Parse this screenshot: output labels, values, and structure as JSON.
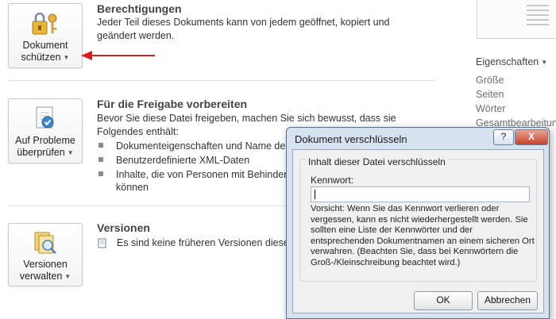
{
  "protect": {
    "button_line1": "Dokument",
    "button_line2": "schützen",
    "title": "Berechtigungen",
    "text": "Jeder Teil dieses Dokuments kann von jedem geöffnet, kopiert und geändert werden."
  },
  "inspect": {
    "button_line1": "Auf Probleme",
    "button_line2": "überprüfen",
    "title": "Für die Freigabe vorbereiten",
    "text": "Bevor Sie diese Datei freigeben, machen Sie sich bewusst, dass sie Folgendes enthält:",
    "bullets": [
      "Dokumenteigenschaften und Name des A",
      "Benutzerdefinierte XML-Daten",
      "Inhalte, die von Personen mit Behinderun"
    ],
    "bullet3_cont": "können"
  },
  "versions": {
    "button_line1": "Versionen",
    "button_line2": "verwalten",
    "title": "Versionen",
    "text": "Es sind keine früheren Versionen dieser D"
  },
  "properties": {
    "header": "Eigenschaften",
    "items": [
      "Größe",
      "Seiten",
      "Wörter",
      "Gesamtbearbeitungs"
    ]
  },
  "dialog": {
    "title": "Dokument verschlüsseln",
    "help": "?",
    "close": "X",
    "group_title": "Inhalt dieser Datei verschlüsseln",
    "password_label": "Kennwort:",
    "password_value": "",
    "warning": "Vorsicht: Wenn Sie das Kennwort verlieren oder vergessen, kann es nicht wiederhergestellt werden. Sie sollten eine Liste der Kennwörter und der entsprechenden Dokumentnamen an einem sicheren Ort verwahren. (Beachten Sie, dass bei Kennwörtern die Groß-/Kleinschreibung beachtet wird.)",
    "ok": "OK",
    "cancel": "Abbrechen"
  },
  "colors": {
    "arrow": "#d9201e",
    "dialog_frame": "#d6e2f0",
    "close_button": "#c5412b"
  }
}
